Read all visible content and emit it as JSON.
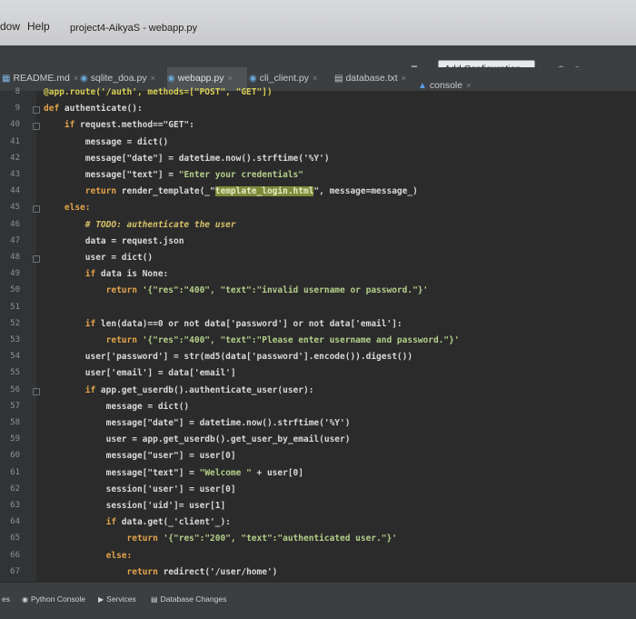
{
  "menu": {
    "window": "dow",
    "help": "Help",
    "project_title": "project4-AikyaS - webapp.py"
  },
  "toolbar": {
    "add_config": "Add Configuration..."
  },
  "tabs": [
    {
      "label": "README.md",
      "close": "×",
      "icon": "markdown-icon"
    },
    {
      "label": "sqlite_doa.py",
      "close": "×",
      "icon": "python-icon"
    },
    {
      "label": "webapp.py",
      "close": "×",
      "icon": "python-icon",
      "active": true
    },
    {
      "label": "cli_client.py",
      "close": "×",
      "icon": "python-icon"
    },
    {
      "label": "database.txt",
      "close": "×",
      "icon": "text-file-icon"
    },
    {
      "label": "console",
      "close": "×",
      "icon": "console-icon"
    }
  ],
  "editor": {
    "line_numbers": [
      "8",
      "9",
      "40",
      "41",
      "42",
      "43",
      "44",
      "45",
      "46",
      "47",
      "48",
      "49",
      "50",
      "51",
      "52",
      "53",
      "54",
      "55",
      "56",
      "57",
      "58",
      "59",
      "60",
      "61",
      "62",
      "63",
      "64",
      "65",
      "66",
      "67"
    ],
    "lines": [
      [
        {
          "t": "@app.route('/auth', methods=[\"POST\", \"GET\"])",
          "c": "dec"
        }
      ],
      [
        {
          "t": "def ",
          "c": "kw"
        },
        {
          "t": "authenticate():"
        }
      ],
      [
        {
          "t": "    if ",
          "c": "kw"
        },
        {
          "t": "request.method==\"GET\":"
        }
      ],
      [
        {
          "t": "        message = dict()"
        }
      ],
      [
        {
          "t": "        message[\"date\"] = datetime.now().strftime('%Y')"
        }
      ],
      [
        {
          "t": "        message[\"text\"] = "
        },
        {
          "t": "\"Enter your credentials\"",
          "c": "str"
        }
      ],
      [
        {
          "t": "        return ",
          "c": "kw"
        },
        {
          "t": "render_template(_\""
        },
        {
          "t": "template_login.html",
          "c": "hl"
        },
        {
          "t": "\", message=message_)"
        }
      ],
      [
        {
          "t": "    else:",
          "c": "kw"
        }
      ],
      [
        {
          "t": "        # TODO: authenticate the user",
          "c": "cm"
        }
      ],
      [
        {
          "t": "        data = request.json"
        }
      ],
      [
        {
          "t": "        user = dict()"
        }
      ],
      [
        {
          "t": "        if ",
          "c": "kw"
        },
        {
          "t": "data is None:"
        }
      ],
      [
        {
          "t": "            return ",
          "c": "kw"
        },
        {
          "t": "'{\"res\":\"400\", \"text\":\"invalid username or password.\"}'",
          "c": "str"
        }
      ],
      [
        {
          "t": ""
        }
      ],
      [
        {
          "t": "        if ",
          "c": "kw"
        },
        {
          "t": "len(data)==0 or not data['password'] or not data['email']:"
        }
      ],
      [
        {
          "t": "            return ",
          "c": "kw"
        },
        {
          "t": "'{\"res\":\"400\", \"text\":\"Please enter username and password.\"}'",
          "c": "str"
        }
      ],
      [
        {
          "t": "        user['password'] = str(md5(data['password'].encode()).digest())"
        }
      ],
      [
        {
          "t": "        user['email'] = data['email']"
        }
      ],
      [
        {
          "t": "        if ",
          "c": "kw"
        },
        {
          "t": "app.get_userdb().authenticate_user(user):"
        }
      ],
      [
        {
          "t": "            message = dict()"
        }
      ],
      [
        {
          "t": "            message[\"date\"] = datetime.now().strftime('%Y')"
        }
      ],
      [
        {
          "t": "            user = app.get_userdb().get_user_by_email(user)"
        }
      ],
      [
        {
          "t": "            message[\"user\"] = user[0]"
        }
      ],
      [
        {
          "t": "            message[\"text\"] = "
        },
        {
          "t": "\"Welcome \"",
          "c": "str"
        },
        {
          "t": " + user[0]"
        }
      ],
      [
        {
          "t": "            session['user'] = user[0]"
        }
      ],
      [
        {
          "t": "            session['uid']= user[1]"
        }
      ],
      [
        {
          "t": "            if ",
          "c": "kw"
        },
        {
          "t": "data.get(_'client'_):"
        }
      ],
      [
        {
          "t": "                return ",
          "c": "kw"
        },
        {
          "t": "'{\"res\":\"200\", \"text\":\"authenticated user.\"}'",
          "c": "str"
        }
      ],
      [
        {
          "t": "            else:",
          "c": "kw"
        }
      ],
      [
        {
          "t": "                return ",
          "c": "kw"
        },
        {
          "t": "redirect('/user/home')"
        }
      ]
    ]
  },
  "bottom": {
    "left": "es",
    "python_console": "Python Console",
    "services": "Services",
    "database_changes": "Database Changes"
  },
  "colors": {
    "keyword": "#e3a44c",
    "string": "#b3cf8a",
    "comment": "#d7c26a",
    "highlight": "#7c8b3a"
  }
}
